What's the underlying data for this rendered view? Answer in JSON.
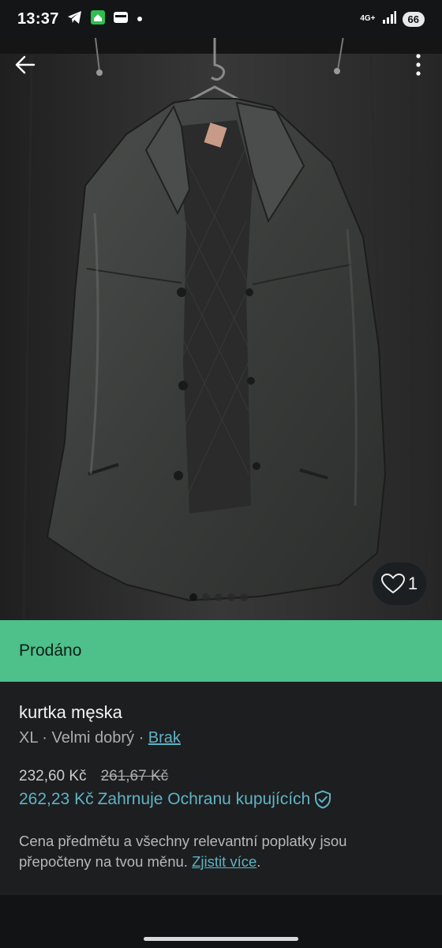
{
  "status_bar": {
    "time": "13:37",
    "network": "4G+",
    "battery": "66",
    "icons": [
      "telegram-icon",
      "home-app-icon",
      "wallet-icon",
      "notification-dot-icon",
      "signal-icon"
    ]
  },
  "photo": {
    "icons": [
      "back-arrow-icon",
      "more-vertical-icon",
      "heart-icon"
    ],
    "like_count": "1",
    "page_dots": 5,
    "active_dot": 1
  },
  "sold_banner": {
    "label": "Prodáno"
  },
  "item": {
    "title": "kurtka męska",
    "size": "XL",
    "separator": " · ",
    "condition": "Velmi dobrý",
    "brand": "Brak",
    "price": "232,60 Kč",
    "original_price": "261,67 Kč",
    "total_price": "262,23 Kč",
    "protection_label": "Zahrnuje Ochranu kupujících",
    "note": "Cena předmětu a všechny relevantní poplatky jsou přepočteny na tvou měnu.",
    "learn_more": "Zjistit více",
    "note_end": "."
  },
  "colors": {
    "sold_banner": "#4ec08a",
    "link": "#5fb3c6",
    "background": "#121314",
    "panel": "#1c1e1f"
  }
}
